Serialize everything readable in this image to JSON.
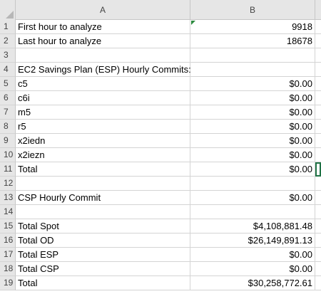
{
  "columns": {
    "a": "A",
    "b": "B"
  },
  "rows": [
    {
      "num": "1",
      "a": "First hour to analyze",
      "b": "9918"
    },
    {
      "num": "2",
      "a": "Last hour to analyze",
      "b": "18678"
    },
    {
      "num": "3",
      "a": "",
      "b": ""
    },
    {
      "num": "4",
      "a": "EC2 Savings Plan (ESP) Hourly Commits:",
      "b": ""
    },
    {
      "num": "5",
      "a": "c5",
      "b": "$0.00"
    },
    {
      "num": "6",
      "a": "c6i",
      "b": "$0.00"
    },
    {
      "num": "7",
      "a": "m5",
      "b": "$0.00"
    },
    {
      "num": "8",
      "a": "r5",
      "b": "$0.00"
    },
    {
      "num": "9",
      "a": "x2iedn",
      "b": "$0.00"
    },
    {
      "num": "10",
      "a": "x2iezn",
      "b": "$0.00"
    },
    {
      "num": "11",
      "a": "Total",
      "b": "$0.00"
    },
    {
      "num": "12",
      "a": "",
      "b": ""
    },
    {
      "num": "13",
      "a": "CSP Hourly Commit",
      "b": "$0.00"
    },
    {
      "num": "14",
      "a": "",
      "b": ""
    },
    {
      "num": "15",
      "a": "Total Spot",
      "b": "$4,108,881.48"
    },
    {
      "num": "16",
      "a": "Total OD",
      "b": "$26,149,891.13"
    },
    {
      "num": "17",
      "a": "Total ESP",
      "b": "$0.00"
    },
    {
      "num": "18",
      "a": "Total CSP",
      "b": "$0.00"
    },
    {
      "num": "19",
      "a": "Total",
      "b": "$30,258,772.61"
    }
  ]
}
